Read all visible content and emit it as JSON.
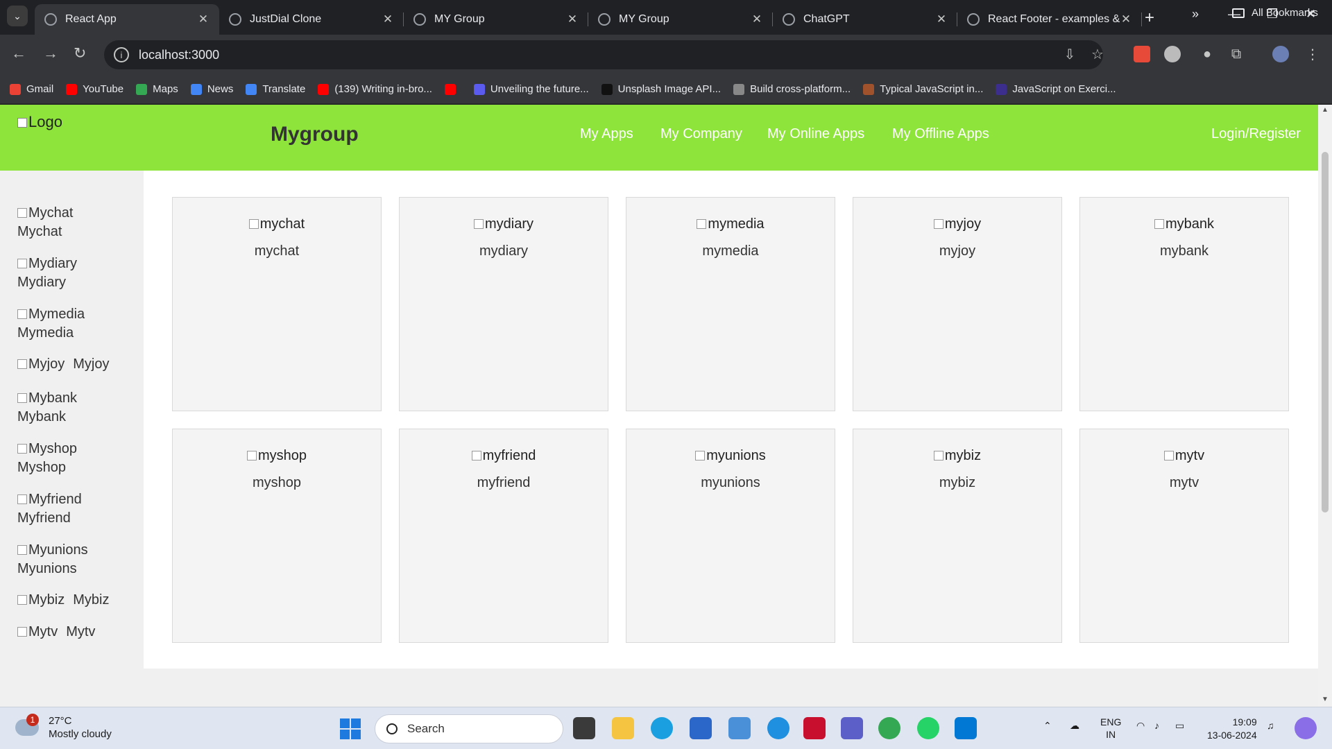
{
  "browser": {
    "tabs": [
      {
        "title": "React App",
        "active": true,
        "icon": "react-icon"
      },
      {
        "title": "JustDial Clone",
        "active": false,
        "icon": "globe-icon"
      },
      {
        "title": "MY Group",
        "active": false,
        "icon": "globe-icon"
      },
      {
        "title": "MY Group",
        "active": false,
        "icon": "globe-icon"
      },
      {
        "title": "ChatGPT",
        "active": false,
        "icon": "chatgpt-icon"
      },
      {
        "title": "React Footer - examples &",
        "active": false,
        "icon": "mdb-icon"
      }
    ],
    "url": "localhost:3000",
    "bookmarks": [
      {
        "label": "Gmail",
        "color": "#ea4335"
      },
      {
        "label": "YouTube",
        "color": "#ff0000"
      },
      {
        "label": "Maps",
        "color": "#34a853"
      },
      {
        "label": "News",
        "color": "#4285f4"
      },
      {
        "label": "Translate",
        "color": "#4285f4"
      },
      {
        "label": "(139) Writing in-bro...",
        "color": "#ff0000"
      },
      {
        "label": "",
        "color": "#ff0000"
      },
      {
        "label": "Unveiling the future...",
        "color": "#5b5bf0"
      },
      {
        "label": "Unsplash Image API...",
        "color": "#111111"
      },
      {
        "label": "Build cross-platform...",
        "color": "#888888"
      },
      {
        "label": "Typical JavaScript in...",
        "color": "#a0522d"
      },
      {
        "label": "JavaScript on Exerci...",
        "color": "#3b2e8c"
      }
    ],
    "all_bookmarks": "All Bookmarks"
  },
  "site": {
    "logo_alt": "Logo",
    "brand": "Mygroup",
    "nav": [
      "My Apps",
      "My Company",
      "My Online Apps",
      "My Offline Apps"
    ],
    "login": "Login/Register",
    "sidebar": [
      {
        "alt": "Mychat",
        "label": "Mychat"
      },
      {
        "alt": "Mydiary",
        "label": "Mydiary"
      },
      {
        "alt": "Mymedia",
        "label": "Mymedia"
      },
      {
        "alt": "Myjoy",
        "label": "Myjoy"
      },
      {
        "alt": "Mybank",
        "label": "Mybank"
      },
      {
        "alt": "Myshop",
        "label": "Myshop"
      },
      {
        "alt": "Myfriend",
        "label": "Myfriend"
      },
      {
        "alt": "Myunions",
        "label": "Myunions"
      },
      {
        "alt": "Mybiz",
        "label": "Mybiz"
      },
      {
        "alt": "Mytv",
        "label": "Mytv"
      }
    ],
    "cards": [
      {
        "alt": "mychat",
        "name": "mychat"
      },
      {
        "alt": "mydiary",
        "name": "mydiary"
      },
      {
        "alt": "mymedia",
        "name": "mymedia"
      },
      {
        "alt": "myjoy",
        "name": "myjoy"
      },
      {
        "alt": "mybank",
        "name": "mybank"
      },
      {
        "alt": "myshop",
        "name": "myshop"
      },
      {
        "alt": "myfriend",
        "name": "myfriend"
      },
      {
        "alt": "myunions",
        "name": "myunions"
      },
      {
        "alt": "mybiz",
        "name": "mybiz"
      },
      {
        "alt": "mytv",
        "name": "mytv"
      }
    ],
    "header_color": "#8ee43a"
  },
  "taskbar": {
    "weather_badge": "1",
    "temperature": "27°C",
    "condition": "Mostly cloudy",
    "search_placeholder": "Search",
    "lang_line1": "ENG",
    "lang_line2": "IN",
    "time": "19:09",
    "date": "13-06-2024"
  }
}
